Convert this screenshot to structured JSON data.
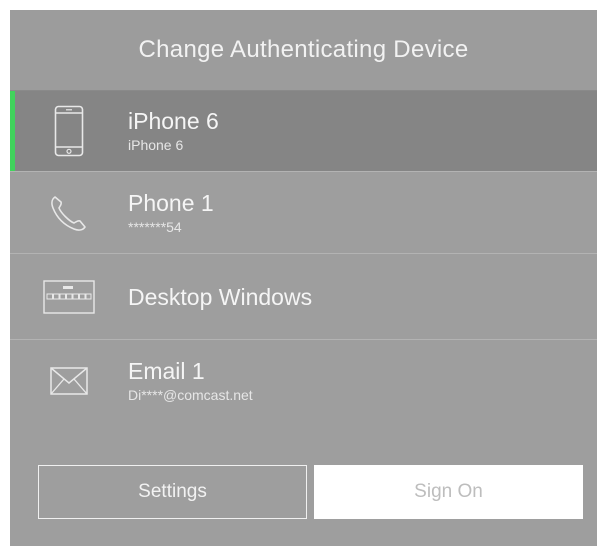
{
  "dialog": {
    "title": "Change Authenticating Device"
  },
  "devices": [
    {
      "name": "iPhone 6",
      "detail": "iPhone 6",
      "icon": "smartphone-icon",
      "selected": true
    },
    {
      "name": "Phone 1",
      "detail": "*******54",
      "icon": "phone-handset-icon",
      "selected": false
    },
    {
      "name": "Desktop Windows",
      "detail": "",
      "icon": "desktop-keyboard-icon",
      "selected": false
    },
    {
      "name": "Email 1",
      "detail": "Di****@comcast.net",
      "icon": "envelope-icon",
      "selected": false
    }
  ],
  "buttons": {
    "settings_label": "Settings",
    "signon_label": "Sign On"
  },
  "colors": {
    "selected_accent": "#41d35c",
    "panel_bg": "#9e9e9e",
    "selected_bg": "#858585"
  }
}
